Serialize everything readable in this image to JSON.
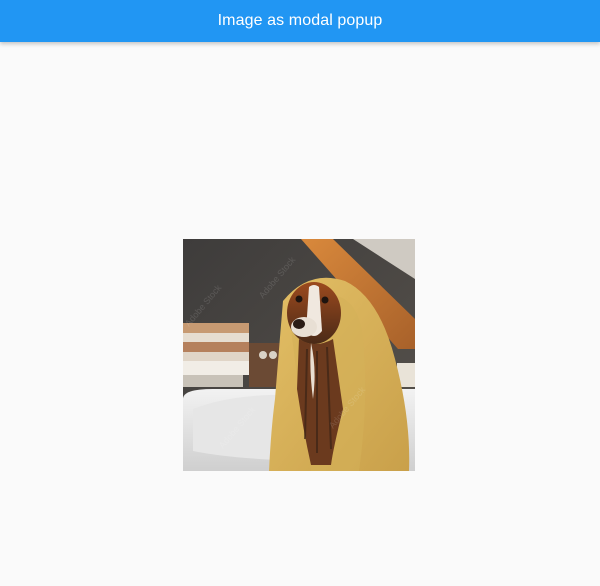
{
  "app_bar": {
    "title": "Image as modal popup",
    "background_color": "#2196f3",
    "title_color": "#ffffff"
  },
  "page": {
    "background_color": "#fafafa"
  },
  "modal_image": {
    "subject": "dog-wrapped-in-towel-photo",
    "watermark": "Adobe Stock"
  }
}
